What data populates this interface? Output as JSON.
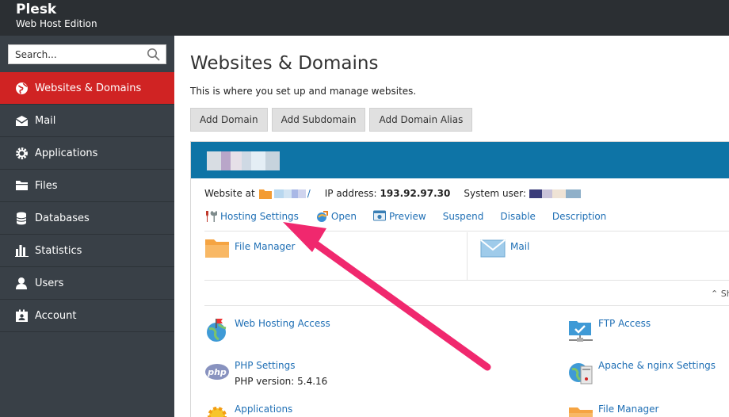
{
  "header": {
    "brand": "Plesk",
    "edition": "Web Host Edition"
  },
  "sidebar": {
    "search_placeholder": "Search...",
    "items": [
      {
        "label": "Websites & Domains",
        "icon": "globe-icon",
        "active": true
      },
      {
        "label": "Mail",
        "icon": "mail-icon"
      },
      {
        "label": "Applications",
        "icon": "gear-icon"
      },
      {
        "label": "Files",
        "icon": "folder-icon"
      },
      {
        "label": "Databases",
        "icon": "database-icon"
      },
      {
        "label": "Statistics",
        "icon": "bar-chart-icon"
      },
      {
        "label": "Users",
        "icon": "user-icon"
      },
      {
        "label": "Account",
        "icon": "account-icon"
      }
    ]
  },
  "main": {
    "title": "Websites & Domains",
    "description": "This is where you set up and manage websites.",
    "buttons": [
      "Add Domain",
      "Add Subdomain",
      "Add Domain Alias"
    ]
  },
  "domain": {
    "website_at_label": "Website at",
    "website_suffix": "/",
    "ip_label": "IP address:",
    "ip_value": "193.92.97.30",
    "system_user_label": "System user:",
    "actions": [
      {
        "label": "Hosting Settings",
        "icon": "tools-icon"
      },
      {
        "label": "Open",
        "icon": "open-icon"
      },
      {
        "label": "Preview",
        "icon": "preview-icon"
      },
      {
        "label": "Suspend"
      },
      {
        "label": "Disable"
      },
      {
        "label": "Description"
      }
    ],
    "top_tiles": [
      {
        "label": "File Manager",
        "icon": "folder-icon"
      },
      {
        "label": "Mail",
        "icon": "envelope-icon"
      }
    ],
    "show_more": "Sh",
    "tiles": [
      {
        "label": "Web Hosting Access",
        "icon": "globe-flag-icon"
      },
      {
        "label": "FTP Access",
        "icon": "ftp-icon"
      },
      {
        "label": "PHP Settings",
        "icon": "php-icon",
        "sub": "PHP version: 5.4.16"
      },
      {
        "label": "Apache & nginx Settings",
        "icon": "apache-icon"
      },
      {
        "label": "Applications",
        "icon": "applications-icon"
      },
      {
        "label": "File Manager",
        "icon": "folder-icon"
      }
    ]
  },
  "colors": {
    "topbar": "#2b2f33",
    "sidebar": "#394047",
    "active": "#d02323",
    "domain_header": "#0e74a6",
    "link": "#1f6fb5",
    "arrow": "#f0286e"
  }
}
